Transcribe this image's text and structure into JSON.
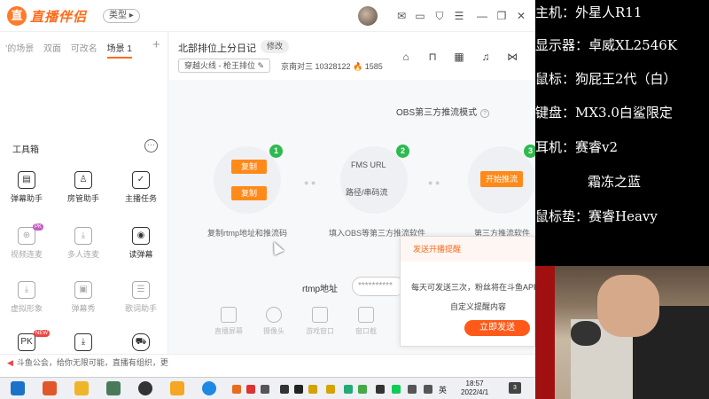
{
  "app": {
    "brand": "直播伴侣",
    "type_button": "类型 ▸"
  },
  "sidebar": {
    "scene_tabs": [
      "’的场景",
      "双面",
      "可改名",
      "场景 1"
    ],
    "toolbox_title": "工具箱",
    "tools": [
      {
        "label": "弹幕助手",
        "icon": "danmu-icon"
      },
      {
        "label": "房管助手",
        "icon": "room-admin-icon"
      },
      {
        "label": "主播任务",
        "icon": "task-icon"
      },
      {
        "label": "视频连麦",
        "icon": "video-link-icon",
        "badge": "PK"
      },
      {
        "label": "多人连麦",
        "icon": "multi-link-icon"
      },
      {
        "label": "读弹幕",
        "icon": "read-danmu-icon"
      },
      {
        "label": "虚拟形象",
        "icon": "avatar-icon"
      },
      {
        "label": "弹幕秀",
        "icon": "danmu-show-icon"
      },
      {
        "label": "歌词助手",
        "icon": "lyrics-icon"
      },
      {
        "label": "PK",
        "icon": "pk-icon",
        "badge": "NEW"
      },
      {
        "label": "",
        "icon": "download-icon"
      },
      {
        "label": "",
        "icon": "car-icon"
      }
    ]
  },
  "notice": "斗鱼公会，给你无限可能，直播有组织，更",
  "room": {
    "title": "北部排位上分日记",
    "edit": "修改",
    "category": "穿越火线 - 枪王排位 ✎",
    "meta": "京南对三   10328122   🔥 1585"
  },
  "obs": {
    "mode_label": "OBS第三方推流模式",
    "copy_label": "复制",
    "fms_url": "FMS URL",
    "stream_key": "路径/串码流",
    "start_push": "开始推流",
    "step_captions": [
      "复制rtmp地址和推流码",
      "填入OBS等第三方推流软件",
      "第三方推流软件"
    ],
    "rtmp_label": "rtmp地址",
    "rtmp_value": "**********"
  },
  "bottom_tools": [
    "直播屏幕",
    "摄像头",
    "游戏窗口",
    "窗口截"
  ],
  "popup": {
    "title": "发送开播提醒",
    "text": "每天可发送三次，粉丝将在斗鱼APP",
    "custom": "自定义提醒内容",
    "send": "立即发送"
  },
  "taskbar": {
    "ime": "英",
    "time": "18:57",
    "date": "2022/4/1",
    "notif_count": "3"
  },
  "specs": [
    "主机：外星人R11",
    "显示器：卓威XL2546K",
    "鼠标：狗屁王2代（白）",
    "键盘：MX3.0白鲨限定",
    "耳机：赛睿v2",
    "霜冻之蓝",
    "鼠标垫：赛睿Heavy"
  ]
}
